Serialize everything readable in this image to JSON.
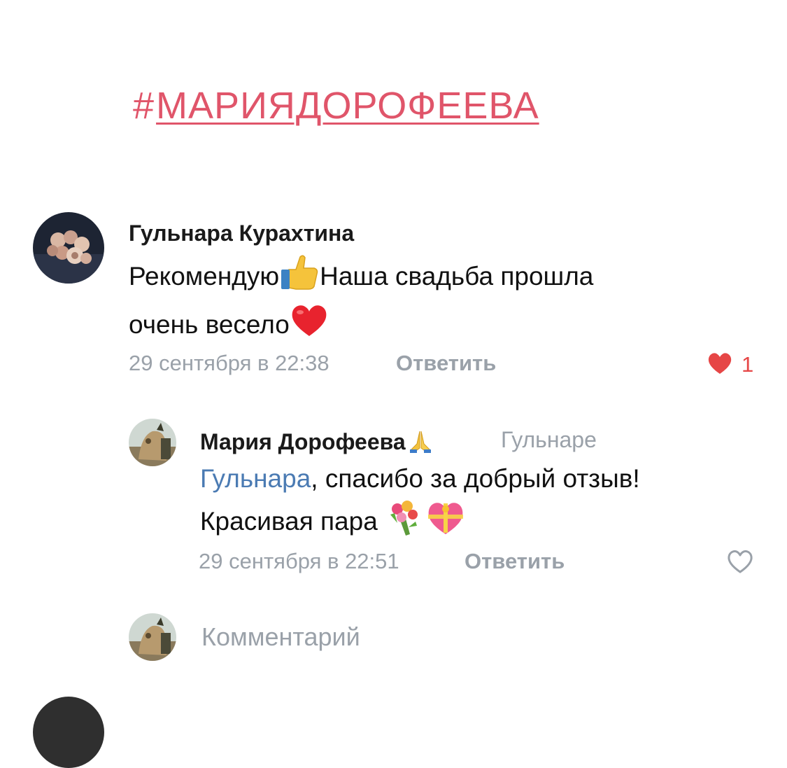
{
  "hashtag": {
    "symbol": "#",
    "tag": "МАРИЯДОРОФЕЕВА"
  },
  "comment": {
    "author": "Гульнара Курахтина",
    "line1_before": "Рекомендую",
    "line1_after": "Наша свадьба прошла",
    "line2": "очень весело",
    "emoji1": "thumbs-up-icon",
    "emoji2": "red-heart-icon",
    "date": "29 сентября в 22:38",
    "reply_label": "Ответить",
    "likes": "1",
    "liked": true
  },
  "reply": {
    "author": "Мария Дорофеева",
    "author_emoji": "folded-hands-icon",
    "to": "Гульнаре",
    "mention": "Гульнара",
    "line1_rest": ", спасибо за добрый отзыв!",
    "line2": "Красивая пара",
    "emoji1": "bouquet-icon",
    "emoji2": "gift-heart-icon",
    "date": "29 сентября в 22:51",
    "reply_label": "Ответить",
    "liked": false
  },
  "composer": {
    "placeholder": "Комментарий"
  },
  "colors": {
    "accent": "#e0556a",
    "mention": "#4b7bb3",
    "muted": "#9aa1a9",
    "like": "#e64646"
  }
}
